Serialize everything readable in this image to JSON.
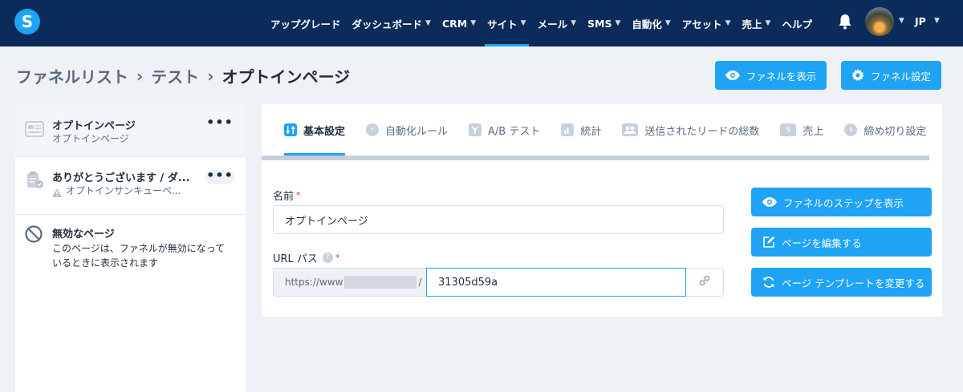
{
  "nav": {
    "logo": "S",
    "items": [
      {
        "label": "アップグレード",
        "has_menu": false
      },
      {
        "label": "ダッシュボード",
        "has_menu": true
      },
      {
        "label": "CRM",
        "has_menu": true
      },
      {
        "label": "サイト",
        "has_menu": true,
        "active": true
      },
      {
        "label": "メール",
        "has_menu": true
      },
      {
        "label": "SMS",
        "has_menu": true
      },
      {
        "label": "自動化",
        "has_menu": true
      },
      {
        "label": "アセット",
        "has_menu": true
      },
      {
        "label": "売上",
        "has_menu": true
      },
      {
        "label": "ヘルプ",
        "has_menu": false
      }
    ],
    "language": "JP",
    "icons": {
      "bell": "bell-icon",
      "avatar": "user-avatar"
    }
  },
  "breadcrumb": {
    "items": [
      "ファネルリスト",
      "テスト",
      "オプトインページ"
    ],
    "separator": "›"
  },
  "header_buttons": {
    "show_funnel": "ファネルを表示",
    "funnel_settings": "ファネル設定"
  },
  "pages": [
    {
      "title": "オプトインページ",
      "subtitle": "オプトインページ",
      "icon": "optin-page-icon",
      "menu": "•••",
      "active": true
    },
    {
      "title": "ありがとうございます / ダ...",
      "subtitle": "オプトインサンキューペ...",
      "icon": "thankyou-page-icon",
      "menu": "•••",
      "warning_icon": "warning-icon"
    },
    {
      "title": "無効なページ",
      "subtitle_lines": [
        "このページは、ファネルが無効になって",
        "いるときに表示されます"
      ],
      "icon": "disabled-icon"
    }
  ],
  "tabs": [
    {
      "label": "基本設定",
      "icon": "sliders-icon",
      "active": true
    },
    {
      "label": "自動化ルール",
      "icon": "lightning-icon"
    },
    {
      "label": "A/B テスト",
      "icon": "split-icon"
    },
    {
      "label": "統計",
      "icon": "bar-chart-icon"
    },
    {
      "label": "送信されたリードの総数",
      "icon": "users-icon"
    },
    {
      "label": "売上",
      "icon": "dollar-icon"
    },
    {
      "label": "締め切り設定",
      "icon": "clock-icon"
    }
  ],
  "form": {
    "name_label": "名前",
    "name_value": "オプトインページ",
    "required_mark": "*",
    "url_label": "URL パス",
    "url_help": "?",
    "url_prefix_start": "https://www",
    "url_prefix_end": "/",
    "url_value": "31305d59a"
  },
  "side_buttons": {
    "show_steps": "ファネルのステップを表示",
    "edit_page": "ページを編集する",
    "change_template": "ページ テンプレートを変更する"
  },
  "colors": {
    "navbar": "#0b2c5a",
    "accent": "#1ea3f5",
    "background": "#eef1f5",
    "required": "#e4344a"
  }
}
